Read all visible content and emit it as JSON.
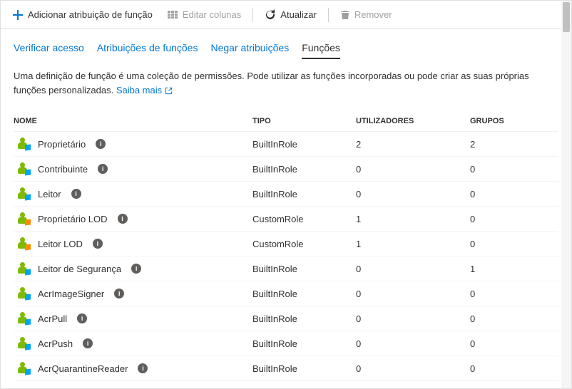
{
  "toolbar": {
    "add": "Adicionar atribuição de função",
    "editColumns": "Editar colunas",
    "refresh": "Atualizar",
    "remove": "Remover"
  },
  "tabs": {
    "verify": "Verificar acesso",
    "assignments": "Atribuições de funções",
    "deny": "Negar atribuições",
    "roles": "Funções"
  },
  "description": {
    "text": "Uma definição de função é uma coleção de permissões. Pode utilizar as funções incorporadas ou pode criar as suas próprias funções personalizadas. ",
    "link": "Saiba mais"
  },
  "headers": {
    "name": "NOME",
    "type": "TIPO",
    "users": "UTILIZADORES",
    "groups": "GRUPOS"
  },
  "rows": [
    {
      "name": "Proprietário",
      "type": "BuiltInRole",
      "users": "2",
      "groups": "2",
      "custom": false
    },
    {
      "name": "Contribuinte",
      "type": "BuiltInRole",
      "users": "0",
      "groups": "0",
      "custom": false
    },
    {
      "name": "Leitor",
      "type": "BuiltInRole",
      "users": "0",
      "groups": "0",
      "custom": false
    },
    {
      "name": "Proprietário LOD",
      "type": "CustomRole",
      "users": "1",
      "groups": "0",
      "custom": true
    },
    {
      "name": "Leitor LOD",
      "type": "CustomRole",
      "users": "1",
      "groups": "0",
      "custom": true
    },
    {
      "name": "Leitor de Segurança",
      "type": "BuiltInRole",
      "users": "0",
      "groups": "1",
      "custom": false
    },
    {
      "name": "AcrImageSigner",
      "type": "BuiltInRole",
      "users": "0",
      "groups": "0",
      "custom": false
    },
    {
      "name": "AcrPull",
      "type": "BuiltInRole",
      "users": "0",
      "groups": "0",
      "custom": false
    },
    {
      "name": "AcrPush",
      "type": "BuiltInRole",
      "users": "0",
      "groups": "0",
      "custom": false
    },
    {
      "name": "AcrQuarantineReader",
      "type": "BuiltInRole",
      "users": "0",
      "groups": "0",
      "custom": false
    }
  ]
}
